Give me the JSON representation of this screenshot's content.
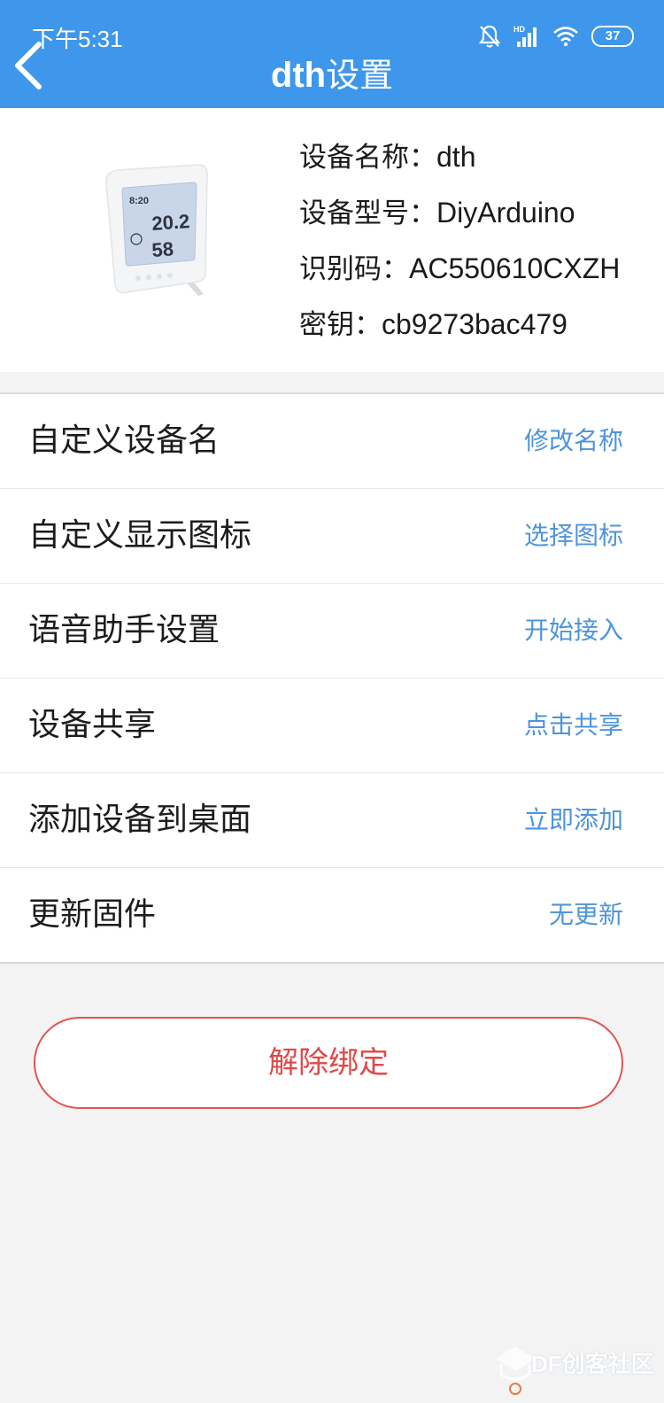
{
  "status_bar": {
    "time": "下午5:31",
    "battery": "37",
    "icons": [
      "mute-bell-icon",
      "hd-signal-icon",
      "wifi-icon",
      "battery-icon"
    ]
  },
  "header": {
    "title_en": "dth",
    "title_cn": "设置",
    "back_icon": "chevron-left-icon"
  },
  "device": {
    "image": "thermometer-hygrometer-device",
    "display_time": "8:20",
    "display_temp": "20.2",
    "display_humidity": "58",
    "name_label": "设备名称：",
    "name_value": "dth",
    "model_label": "设备型号：",
    "model_value": "DiyArduino",
    "id_label": "识别码：",
    "id_value": "AC550610CXZH",
    "key_label": "密钥：",
    "key_value": "cb9273bac479"
  },
  "settings": [
    {
      "label": "自定义设备名",
      "action": "修改名称"
    },
    {
      "label": "自定义显示图标",
      "action": "选择图标"
    },
    {
      "label": "语音助手设置",
      "action": "开始接入"
    },
    {
      "label": "设备共享",
      "action": "点击共享"
    },
    {
      "label": "添加设备到桌面",
      "action": "立即添加"
    },
    {
      "label": "更新固件",
      "action": "无更新"
    }
  ],
  "unbind_button": "解除绑定",
  "watermark": {
    "text": "DF创客社区"
  },
  "colors": {
    "header": "#3e97ea",
    "action_text": "#4e94dc",
    "danger": "#e05454",
    "background": "#f3f3f3"
  }
}
